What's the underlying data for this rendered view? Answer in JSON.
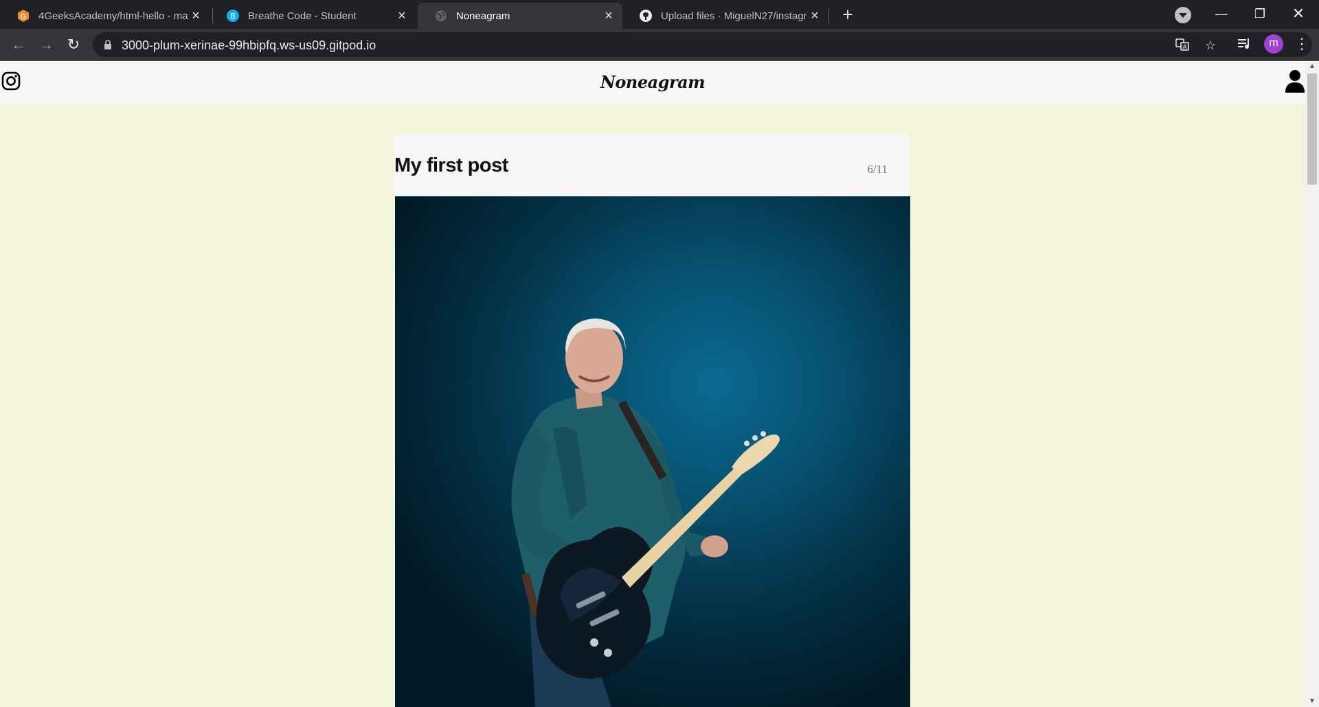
{
  "browser": {
    "tabs": [
      {
        "title": "4GeeksAcademy/html-hello - ma",
        "icon": "4geeks-icon",
        "active": false
      },
      {
        "title": "Breathe Code - Student",
        "icon": "breathecode-icon",
        "active": false
      },
      {
        "title": "Noneagram",
        "icon": "globe-icon",
        "active": true
      },
      {
        "title": "Upload files · MiguelN27/instagr",
        "icon": "github-icon",
        "active": false
      }
    ],
    "url": "3000-plum-xerinae-99hbipfq.ws-us09.gitpod.io",
    "profile_initial": "m"
  },
  "site": {
    "brand": "Noneagram"
  },
  "post": {
    "title": "My first post",
    "date": "6/11",
    "image_alt": "Guitarist in a blue shirt playing a black electric guitar against a blue background"
  }
}
